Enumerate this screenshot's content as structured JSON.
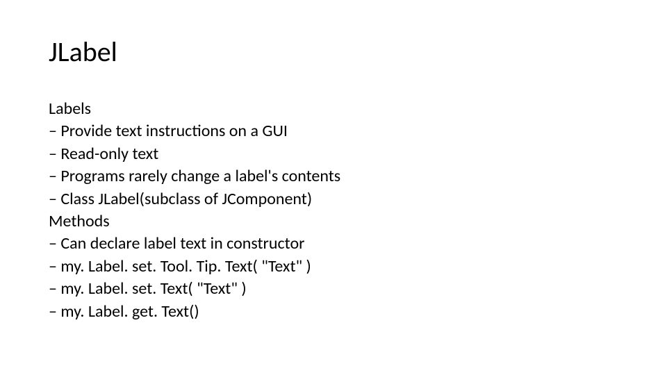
{
  "title": "JLabel",
  "content": {
    "lines": [
      "Labels",
      "– Provide text instructions on a GUI",
      "– Read-only text",
      "– Programs rarely change a label's contents",
      "– Class JLabel(subclass of JComponent)",
      "Methods",
      "– Can declare label text in constructor",
      "– my. Label. set. Tool. Tip. Text( \"Text\" )",
      "– my. Label. set. Text( \"Text\" )",
      "– my. Label. get. Text()"
    ]
  }
}
